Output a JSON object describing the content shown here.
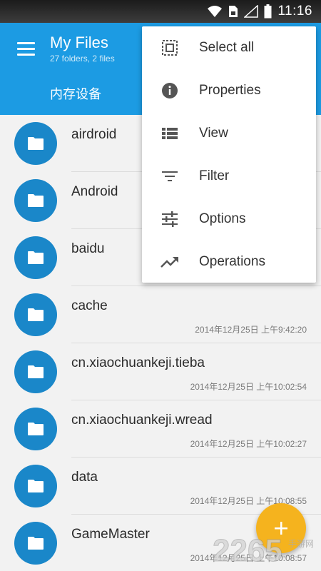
{
  "status_bar": {
    "time": "11:16"
  },
  "app_bar": {
    "title": "My Files",
    "subtitle": "27 folders, 2 files",
    "storage_tab": "内存设备"
  },
  "files": [
    {
      "name": "airdroid",
      "date": ""
    },
    {
      "name": "Android",
      "date": ""
    },
    {
      "name": "baidu",
      "date": ""
    },
    {
      "name": "cache",
      "date": "2014年12月25日 上午9:42:20"
    },
    {
      "name": "cn.xiaochuankeji.tieba",
      "date": "2014年12月25日 上午10:02:54"
    },
    {
      "name": "cn.xiaochuankeji.wread",
      "date": "2014年12月25日 上午10:02:27"
    },
    {
      "name": "data",
      "date": "2014年12月25日 上午10:08:55"
    },
    {
      "name": "GameMaster",
      "date": "2014年12月25日 上午10:08:57"
    }
  ],
  "overflow_menu": [
    {
      "label": "Select all",
      "icon": "select-all-icon"
    },
    {
      "label": "Properties",
      "icon": "info-icon"
    },
    {
      "label": "View",
      "icon": "list-view-icon"
    },
    {
      "label": "Filter",
      "icon": "filter-icon"
    },
    {
      "label": "Options",
      "icon": "tune-icon"
    },
    {
      "label": "Operations",
      "icon": "trending-icon"
    }
  ],
  "watermark": {
    "text": "2265",
    "sub": "手游网"
  },
  "colors": {
    "primary": "#1c9be3",
    "folder": "#1a87c9",
    "fab": "#f5b31e"
  }
}
